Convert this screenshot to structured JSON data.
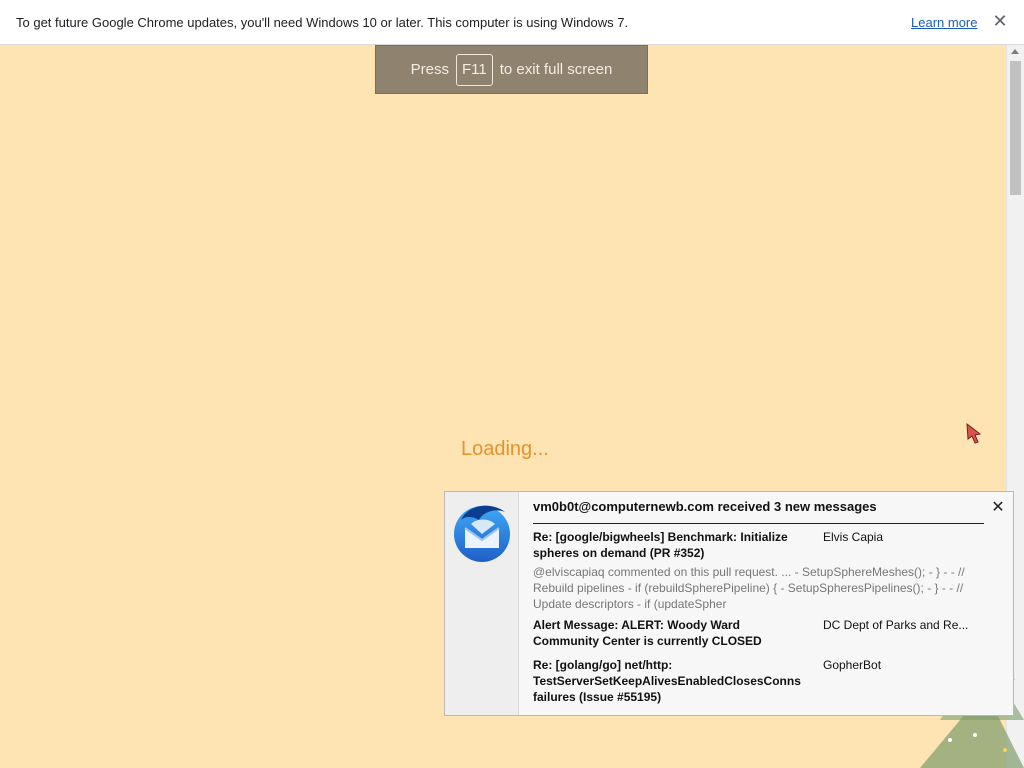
{
  "infobar": {
    "message": "To get future Google Chrome updates, you'll need Windows 10 or later. This computer is using Windows 7.",
    "learn_more": "Learn more",
    "close_glyph": "✕"
  },
  "fullscreen_toast": {
    "prefix": "Press",
    "key": "F11",
    "suffix": "to exit full screen"
  },
  "page": {
    "loading_text": "Loading..."
  },
  "notification": {
    "header": "vm0b0t@computernewb.com received 3 new messages",
    "close_glyph": "✕",
    "messages": [
      {
        "subject": "Re: [google/bigwheels] Benchmark: Initialize spheres on demand (PR #352)",
        "from": "Elvis Capia",
        "preview": "@elviscapiaq commented on this pull request. ... - SetupSphereMeshes(); - } - - // Rebuild pipelines - if (rebuildSpherePipeline) { - SetupSpheresPipelines(); - } - - // Update descriptors - if (updateSpher"
      },
      {
        "subject": "Alert Message: ALERT: Woody Ward Community Center is currently CLOSED",
        "from": "DC Dept of Parks and Re..."
      },
      {
        "subject": "Re: [golang/go] net/http: TestServerSetKeepAlivesEnabledClosesConns failures (Issue #55195)",
        "from": "GopherBot"
      }
    ]
  },
  "colors": {
    "page_background": "#ffe4b3",
    "loading_text": "#e4932c",
    "toast_background": "#8f826f"
  }
}
